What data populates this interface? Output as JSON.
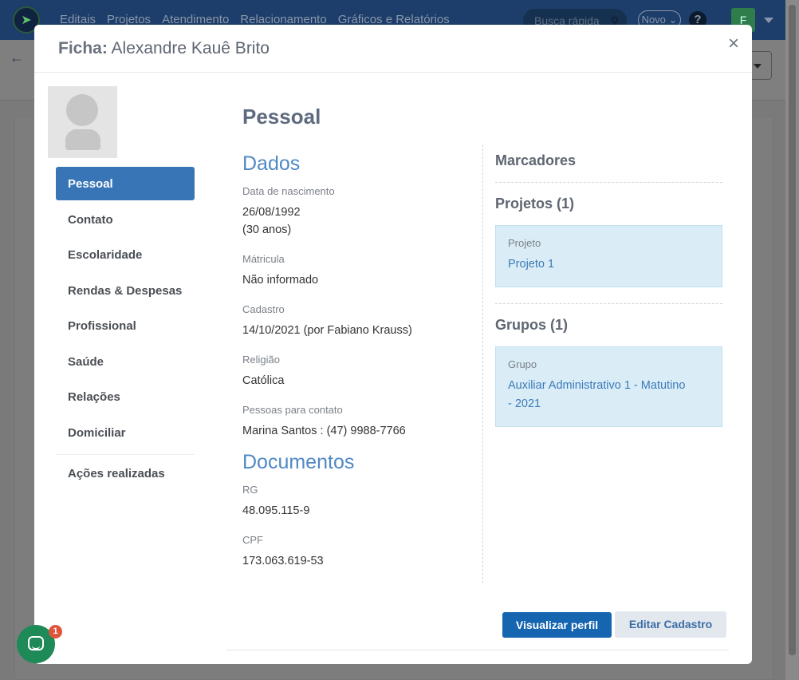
{
  "app": {
    "nav": [
      "Editais",
      "Projetos",
      "Atendimento",
      "Relacionamento",
      "Gráficos e Relatórios"
    ],
    "quick_search_placeholder": "Busca rápida",
    "novo_label": "Novo",
    "help_label": "?",
    "user_initial": "F"
  },
  "modal": {
    "title_prefix": "Ficha:",
    "title_name": "Alexandre Kauê Brito",
    "close_label": "×"
  },
  "menu": {
    "items": [
      "Pessoal",
      "Contato",
      "Escolaridade",
      "Rendas & Despesas",
      "Profissional",
      "Saúde",
      "Relações",
      "Domiciliar"
    ],
    "active_index": 0,
    "extra": "Ações realizadas"
  },
  "content": {
    "title": "Pessoal",
    "dados_heading": "Dados",
    "fields": [
      {
        "label": "Data de nascimento",
        "value": "26/08/1992",
        "value2": "(30 anos)"
      },
      {
        "label": "Mátricula",
        "value": "Não informado"
      },
      {
        "label": "Cadastro",
        "value": "14/10/2021 (por Fabiano Krauss)"
      },
      {
        "label": "Religião",
        "value": "Católica"
      },
      {
        "label": "Pessoas para contato",
        "value": "Marina Santos : (47) 9988-7766"
      }
    ],
    "documentos_heading": "Documentos",
    "docs": [
      {
        "label": "RG",
        "value": "48.095.115-9"
      },
      {
        "label": "CPF",
        "value": "173.063.619-53"
      }
    ]
  },
  "right": {
    "marcadores": "Marcadores",
    "projetos_heading": "Projetos (1)",
    "projeto_label": "Projeto",
    "projeto_value": "Projeto 1",
    "grupos_heading": "Grupos (1)",
    "grupo_label": "Grupo",
    "grupo_value_line1": "Auxiliar Administrativo 1 - Matutino",
    "grupo_value_line2": "- 2021"
  },
  "footer": {
    "primary": "Visualizar perfil",
    "secondary": "Editar Cadastro"
  },
  "chat": {
    "badge": "1"
  },
  "colors": {
    "primary": "#1565b0",
    "active_menu": "#3775b6",
    "section_blue": "#4f88c6",
    "box_bg": "#daedf7"
  }
}
